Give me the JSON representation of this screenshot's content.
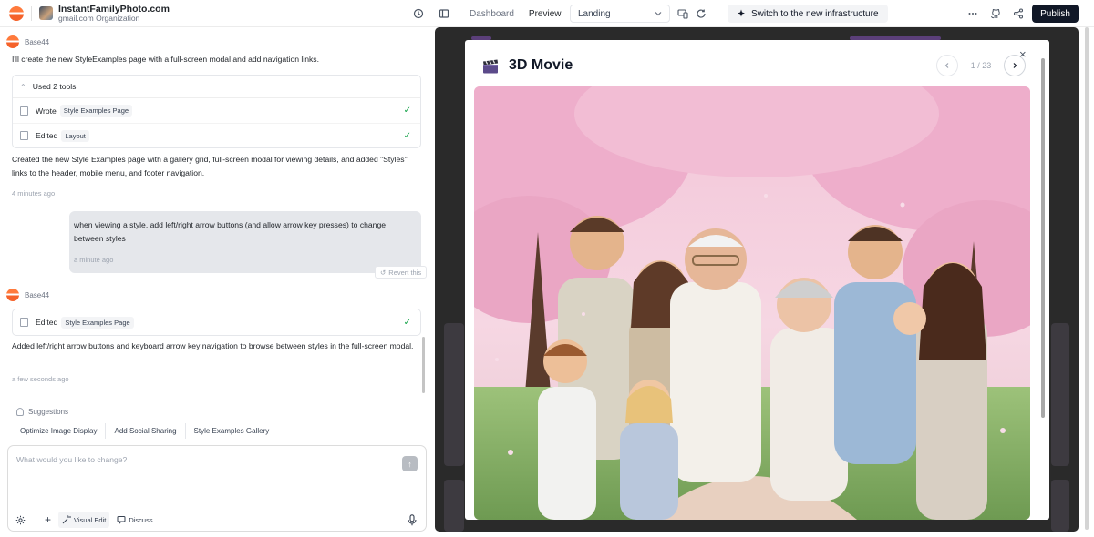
{
  "header": {
    "app_name": "InstantFamilyPhoto.com",
    "org": "gmail.com Organization",
    "tabs": [
      {
        "label": "Dashboard",
        "active": false
      },
      {
        "label": "Preview",
        "active": true
      }
    ],
    "page_select": "Landing",
    "switch_label": "Switch to the new infrastructure",
    "publish_label": "Publish",
    "icons": [
      "history-icon",
      "sidebar-toggle-icon",
      "devices-icon",
      "refresh-icon",
      "more-icon",
      "github-icon",
      "share-icon"
    ]
  },
  "chat": {
    "agent_name": "Base44",
    "msg1": "I'll create the new StyleExamples page with a full-screen modal and add navigation links.",
    "tools": {
      "header": "Used 2 tools",
      "items": [
        {
          "action": "Wrote",
          "file": "Style Examples Page"
        },
        {
          "action": "Edited",
          "file": "Layout"
        }
      ]
    },
    "msg2": "Created the new Style Examples page with a gallery grid, full-screen modal for viewing details, and added \"Styles\" links to the header, mobile menu, and footer navigation.",
    "time1": "4 minutes ago",
    "user_msg": "when viewing a style, add left/right arrow buttons (and allow arrow key presses) to change between styles",
    "user_time": "a minute ago",
    "revert_label": "Revert this",
    "agent_name2": "Base44",
    "edit2": {
      "action": "Edited",
      "file": "Style Examples Page"
    },
    "msg3": "Added left/right arrow buttons and keyboard arrow key navigation to browse between styles in the full-screen modal.",
    "time2": "a few seconds ago",
    "suggestions_label": "Suggestions",
    "suggestions": [
      "Optimize Image Display",
      "Add Social Sharing",
      "Style Examples Gallery"
    ],
    "input_placeholder": "What would you like to change?",
    "input_value": "",
    "visual_edit_label": "Visual Edit",
    "discuss_label": "Discuss"
  },
  "modal": {
    "title": "3D Movie",
    "page_current": "1 / 23",
    "icon": "clapperboard-icon"
  },
  "colors": {
    "accent": "#f5622a",
    "publish_bg": "#111827",
    "check": "#16a34a",
    "preview_bg": "#2a2a2a"
  }
}
